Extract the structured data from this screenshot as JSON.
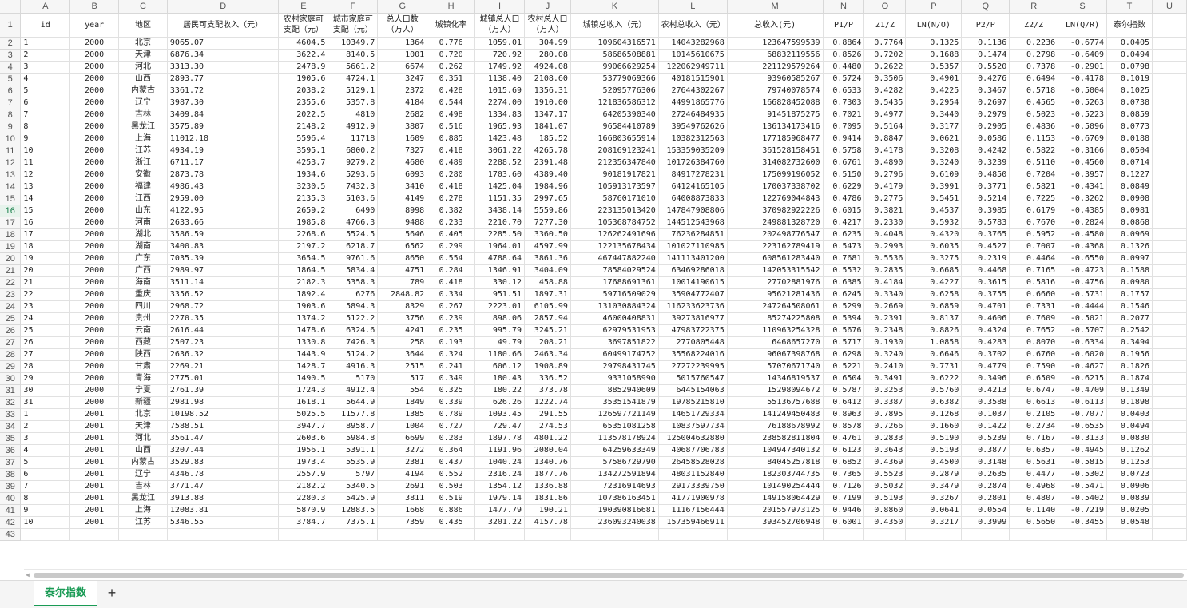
{
  "columns": [
    "A",
    "B",
    "C",
    "D",
    "E",
    "F",
    "G",
    "H",
    "I",
    "J",
    "K",
    "L",
    "M",
    "N",
    "O",
    "P",
    "Q",
    "R",
    "S",
    "T",
    "U"
  ],
  "headers": [
    "id",
    "year",
    "地区",
    "居民可支配收入（元）",
    "农村家庭可支配（元）",
    "城市家庭可支配（元）",
    "总人口数（万人）",
    "城镇化率",
    "城镇总人口（万人）",
    "农村总人口（万人）",
    "城镇总收入（元）",
    "农村总收入（元）",
    "总收入(元)",
    "P1/P",
    "Z1/Z",
    "LN(N/O)",
    "P2/P",
    "Z2/Z",
    "LN(Q/R)",
    "泰尔指数",
    ""
  ],
  "rows": [
    [
      "1",
      "2000",
      "北京",
      "9065.07",
      "4604.5",
      "10349.7",
      "1364",
      "0.776",
      "1059.01",
      "304.99",
      "109604316571",
      "14043282968",
      "123647599539",
      "0.8864",
      "0.7764",
      "0.1325",
      "0.1136",
      "0.2236",
      "-0.6774",
      "0.0405"
    ],
    [
      "2",
      "2000",
      "天津",
      "6876.34",
      "3622.4",
      "8140.5",
      "1001",
      "0.720",
      "720.92",
      "280.08",
      "58686508881",
      "10145610675",
      "68832119556",
      "0.8526",
      "0.7202",
      "0.1688",
      "0.1474",
      "0.2798",
      "-0.6409",
      "0.0494"
    ],
    [
      "3",
      "2000",
      "河北",
      "3313.30",
      "2478.9",
      "5661.2",
      "6674",
      "0.262",
      "1749.92",
      "4924.08",
      "99066629254",
      "122062949711",
      "221129579264",
      "0.4480",
      "0.2622",
      "0.5357",
      "0.5520",
      "0.7378",
      "-0.2901",
      "0.0798"
    ],
    [
      "4",
      "2000",
      "山西",
      "2893.77",
      "1905.6",
      "4724.1",
      "3247",
      "0.351",
      "1138.40",
      "2108.60",
      "53779069366",
      "40181515901",
      "93960585267",
      "0.5724",
      "0.3506",
      "0.4901",
      "0.4276",
      "0.6494",
      "-0.4178",
      "0.1019"
    ],
    [
      "5",
      "2000",
      "内蒙古",
      "3361.72",
      "2038.2",
      "5129.1",
      "2372",
      "0.428",
      "1015.69",
      "1356.31",
      "52095776306",
      "27644302267",
      "79740078574",
      "0.6533",
      "0.4282",
      "0.4225",
      "0.3467",
      "0.5718",
      "-0.5004",
      "0.1025"
    ],
    [
      "6",
      "2000",
      "辽宁",
      "3987.30",
      "2355.6",
      "5357.8",
      "4184",
      "0.544",
      "2274.00",
      "1910.00",
      "121836586312",
      "44991865776",
      "166828452088",
      "0.7303",
      "0.5435",
      "0.2954",
      "0.2697",
      "0.4565",
      "-0.5263",
      "0.0738"
    ],
    [
      "7",
      "2000",
      "吉林",
      "3409.84",
      "2022.5",
      "4810",
      "2682",
      "0.498",
      "1334.83",
      "1347.17",
      "64205390340",
      "27246484935",
      "91451875275",
      "0.7021",
      "0.4977",
      "0.3440",
      "0.2979",
      "0.5023",
      "-0.5223",
      "0.0859"
    ],
    [
      "8",
      "2000",
      "黑龙江",
      "3575.89",
      "2148.2",
      "4912.9",
      "3807",
      "0.516",
      "1965.93",
      "1841.07",
      "96584410789",
      "39549762626",
      "136134173416",
      "0.7095",
      "0.5164",
      "0.3177",
      "0.2905",
      "0.4836",
      "-0.5096",
      "0.0773"
    ],
    [
      "9",
      "2000",
      "上海",
      "11012.18",
      "5596.4",
      "11718",
      "1609",
      "0.885",
      "1423.48",
      "185.52",
      "166803655914",
      "10382312563",
      "177185968477",
      "0.9414",
      "0.8847",
      "0.0621",
      "0.0586",
      "0.1153",
      "-0.6769",
      "0.0188"
    ],
    [
      "10",
      "2000",
      "江苏",
      "4934.19",
      "3595.1",
      "6800.2",
      "7327",
      "0.418",
      "3061.22",
      "4265.78",
      "208169123241",
      "153359035209",
      "361528158451",
      "0.5758",
      "0.4178",
      "0.3208",
      "0.4242",
      "0.5822",
      "-0.3166",
      "0.0504"
    ],
    [
      "11",
      "2000",
      "浙江",
      "6711.17",
      "4253.7",
      "9279.2",
      "4680",
      "0.489",
      "2288.52",
      "2391.48",
      "212356347840",
      "101726384760",
      "314082732600",
      "0.6761",
      "0.4890",
      "0.3240",
      "0.3239",
      "0.5110",
      "-0.4560",
      "0.0714"
    ],
    [
      "12",
      "2000",
      "安徽",
      "2873.78",
      "1934.6",
      "5293.6",
      "6093",
      "0.280",
      "1703.60",
      "4389.40",
      "90181917821",
      "84917278231",
      "175099196052",
      "0.5150",
      "0.2796",
      "0.6109",
      "0.4850",
      "0.7204",
      "-0.3957",
      "0.1227"
    ],
    [
      "13",
      "2000",
      "福建",
      "4986.43",
      "3230.5",
      "7432.3",
      "3410",
      "0.418",
      "1425.04",
      "1984.96",
      "105913173597",
      "64124165105",
      "170037338702",
      "0.6229",
      "0.4179",
      "0.3991",
      "0.3771",
      "0.5821",
      "-0.4341",
      "0.0849"
    ],
    [
      "14",
      "2000",
      "江西",
      "2959.00",
      "2135.3",
      "5103.6",
      "4149",
      "0.278",
      "1151.35",
      "2997.65",
      "58760171010",
      "64008873833",
      "122769044843",
      "0.4786",
      "0.2775",
      "0.5451",
      "0.5214",
      "0.7225",
      "-0.3262",
      "0.0908"
    ],
    [
      "15",
      "2000",
      "山东",
      "4122.95",
      "2659.2",
      "6490",
      "8998",
      "0.382",
      "3438.14",
      "5559.86",
      "223135013420",
      "147847908806",
      "370982922226",
      "0.6015",
      "0.3821",
      "0.4537",
      "0.3985",
      "0.6179",
      "-0.4385",
      "0.0981"
    ],
    [
      "16",
      "2000",
      "河南",
      "2633.66",
      "1985.8",
      "4766.3",
      "9488",
      "0.233",
      "2210.70",
      "7277.30",
      "105368784752",
      "144512543968",
      "249881328720",
      "0.4217",
      "0.2330",
      "0.5932",
      "0.5783",
      "0.7670",
      "-0.2824",
      "0.0868"
    ],
    [
      "17",
      "2000",
      "湖北",
      "3586.59",
      "2268.6",
      "5524.5",
      "5646",
      "0.405",
      "2285.50",
      "3360.50",
      "126262491696",
      "76236284851",
      "202498776547",
      "0.6235",
      "0.4048",
      "0.4320",
      "0.3765",
      "0.5952",
      "-0.4580",
      "0.0969"
    ],
    [
      "18",
      "2000",
      "湖南",
      "3400.83",
      "2197.2",
      "6218.7",
      "6562",
      "0.299",
      "1964.01",
      "4597.99",
      "122135678434",
      "101027110985",
      "223162789419",
      "0.5473",
      "0.2993",
      "0.6035",
      "0.4527",
      "0.7007",
      "-0.4368",
      "0.1326"
    ],
    [
      "19",
      "2000",
      "广东",
      "7035.39",
      "3654.5",
      "9761.6",
      "8650",
      "0.554",
      "4788.64",
      "3861.36",
      "467447882240",
      "141113401200",
      "608561283440",
      "0.7681",
      "0.5536",
      "0.3275",
      "0.2319",
      "0.4464",
      "-0.6550",
      "0.0997"
    ],
    [
      "20",
      "2000",
      "广西",
      "2989.97",
      "1864.5",
      "5834.4",
      "4751",
      "0.284",
      "1346.91",
      "3404.09",
      "78584029524",
      "63469286018",
      "142053315542",
      "0.5532",
      "0.2835",
      "0.6685",
      "0.4468",
      "0.7165",
      "-0.4723",
      "0.1588"
    ],
    [
      "21",
      "2000",
      "海南",
      "3511.14",
      "2182.3",
      "5358.3",
      "789",
      "0.418",
      "330.12",
      "458.88",
      "17688691361",
      "10014190615",
      "27702881976",
      "0.6385",
      "0.4184",
      "0.4227",
      "0.3615",
      "0.5816",
      "-0.4756",
      "0.0980"
    ],
    [
      "22",
      "2000",
      "重庆",
      "3356.52",
      "1892.4",
      "6276",
      "2848.82",
      "0.334",
      "951.51",
      "1897.31",
      "59716509029",
      "35904772407",
      "95621281436",
      "0.6245",
      "0.3340",
      "0.6258",
      "0.3755",
      "0.6660",
      "-0.5731",
      "0.1757"
    ],
    [
      "23",
      "2000",
      "四川",
      "2968.72",
      "1903.6",
      "5894.3",
      "8329",
      "0.267",
      "2223.01",
      "6105.99",
      "131030884324",
      "116233623736",
      "247264508061",
      "0.5299",
      "0.2669",
      "0.6859",
      "0.4701",
      "0.7331",
      "-0.4444",
      "0.1546"
    ],
    [
      "24",
      "2000",
      "贵州",
      "2270.35",
      "1374.2",
      "5122.2",
      "3756",
      "0.239",
      "898.06",
      "2857.94",
      "46000408831",
      "39273816977",
      "85274225808",
      "0.5394",
      "0.2391",
      "0.8137",
      "0.4606",
      "0.7609",
      "-0.5021",
      "0.2077"
    ],
    [
      "25",
      "2000",
      "云南",
      "2616.44",
      "1478.6",
      "6324.6",
      "4241",
      "0.235",
      "995.79",
      "3245.21",
      "62979531953",
      "47983722375",
      "110963254328",
      "0.5676",
      "0.2348",
      "0.8826",
      "0.4324",
      "0.7652",
      "-0.5707",
      "0.2542"
    ],
    [
      "26",
      "2000",
      "西藏",
      "2507.23",
      "1330.8",
      "7426.3",
      "258",
      "0.193",
      "49.79",
      "208.21",
      "3697851822",
      "2770805448",
      "6468657270",
      "0.5717",
      "0.1930",
      "1.0858",
      "0.4283",
      "0.8070",
      "-0.6334",
      "0.3494"
    ],
    [
      "27",
      "2000",
      "陕西",
      "2636.32",
      "1443.9",
      "5124.2",
      "3644",
      "0.324",
      "1180.66",
      "2463.34",
      "60499174752",
      "35568224016",
      "96067398768",
      "0.6298",
      "0.3240",
      "0.6646",
      "0.3702",
      "0.6760",
      "-0.6020",
      "0.1956"
    ],
    [
      "28",
      "2000",
      "甘肃",
      "2269.21",
      "1428.7",
      "4916.3",
      "2515",
      "0.241",
      "606.12",
      "1908.89",
      "29798431745",
      "27272239995",
      "57070671740",
      "0.5221",
      "0.2410",
      "0.7731",
      "0.4779",
      "0.7590",
      "-0.4627",
      "0.1826"
    ],
    [
      "29",
      "2000",
      "青海",
      "2775.01",
      "1490.5",
      "5170",
      "517",
      "0.349",
      "180.43",
      "336.52",
      "9331058990",
      "5015760547",
      "14346819537",
      "0.6504",
      "0.3491",
      "0.6222",
      "0.3496",
      "0.6509",
      "-0.6215",
      "0.1874"
    ],
    [
      "30",
      "2000",
      "宁夏",
      "2761.39",
      "1724.3",
      "4912.4",
      "554",
      "0.325",
      "180.22",
      "373.78",
      "8852940609",
      "6445154063",
      "15298094672",
      "0.5787",
      "0.3253",
      "0.5760",
      "0.4213",
      "0.6747",
      "-0.4709",
      "0.1349"
    ],
    [
      "31",
      "2000",
      "新疆",
      "2981.98",
      "1618.1",
      "5644.9",
      "1849",
      "0.339",
      "626.26",
      "1222.74",
      "35351541879",
      "19785215810",
      "55136757688",
      "0.6412",
      "0.3387",
      "0.6382",
      "0.3588",
      "0.6613",
      "-0.6113",
      "0.1898"
    ],
    [
      "1",
      "2001",
      "北京",
      "10198.52",
      "5025.5",
      "11577.8",
      "1385",
      "0.789",
      "1093.45",
      "291.55",
      "126597721149",
      "14651729334",
      "141249450483",
      "0.8963",
      "0.7895",
      "0.1268",
      "0.1037",
      "0.2105",
      "-0.7077",
      "0.0403"
    ],
    [
      "2",
      "2001",
      "天津",
      "7588.51",
      "3947.7",
      "8958.7",
      "1004",
      "0.727",
      "729.47",
      "274.53",
      "65351081258",
      "10837597734",
      "76188678992",
      "0.8578",
      "0.7266",
      "0.1660",
      "0.1422",
      "0.2734",
      "-0.6535",
      "0.0494"
    ],
    [
      "3",
      "2001",
      "河北",
      "3561.47",
      "2603.6",
      "5984.8",
      "6699",
      "0.283",
      "1897.78",
      "4801.22",
      "113578178924",
      "125004632880",
      "238582811804",
      "0.4761",
      "0.2833",
      "0.5190",
      "0.5239",
      "0.7167",
      "-0.3133",
      "0.0830"
    ],
    [
      "4",
      "2001",
      "山西",
      "3207.44",
      "1956.1",
      "5391.1",
      "3272",
      "0.364",
      "1191.96",
      "2080.04",
      "64259633349",
      "40687706783",
      "104947340132",
      "0.6123",
      "0.3643",
      "0.5193",
      "0.3877",
      "0.6357",
      "-0.4945",
      "0.1262"
    ],
    [
      "5",
      "2001",
      "内蒙古",
      "3529.83",
      "1973.4",
      "5535.9",
      "2381",
      "0.437",
      "1040.24",
      "1340.76",
      "57586729790",
      "26458528028",
      "84045257818",
      "0.6852",
      "0.4369",
      "0.4500",
      "0.3148",
      "0.5631",
      "-0.5815",
      "0.1253"
    ],
    [
      "6",
      "2001",
      "辽宁",
      "4346.78",
      "2557.9",
      "5797",
      "4194",
      "0.552",
      "2316.24",
      "1877.76",
      "134272591894",
      "48031152840",
      "182303744735",
      "0.7365",
      "0.5523",
      "0.2879",
      "0.2635",
      "0.4477",
      "-0.5302",
      "0.0723"
    ],
    [
      "7",
      "2001",
      "吉林",
      "3771.47",
      "2182.2",
      "5340.5",
      "2691",
      "0.503",
      "1354.12",
      "1336.88",
      "72316914693",
      "29173339750",
      "101490254444",
      "0.7126",
      "0.5032",
      "0.3479",
      "0.2874",
      "0.4968",
      "-0.5471",
      "0.0906"
    ],
    [
      "8",
      "2001",
      "黑龙江",
      "3913.88",
      "2280.3",
      "5425.9",
      "3811",
      "0.519",
      "1979.14",
      "1831.86",
      "107386163451",
      "41771900978",
      "149158064429",
      "0.7199",
      "0.5193",
      "0.3267",
      "0.2801",
      "0.4807",
      "-0.5402",
      "0.0839"
    ],
    [
      "9",
      "2001",
      "上海",
      "12083.81",
      "5870.9",
      "12883.5",
      "1668",
      "0.886",
      "1477.79",
      "190.21",
      "190390816681",
      "11167156444",
      "201557973125",
      "0.9446",
      "0.8860",
      "0.0641",
      "0.0554",
      "0.1140",
      "-0.7219",
      "0.0205"
    ],
    [
      "10",
      "2001",
      "江苏",
      "5346.55",
      "3784.7",
      "7375.1",
      "7359",
      "0.435",
      "3201.22",
      "4157.78",
      "236093240038",
      "157359466911",
      "393452706948",
      "0.6001",
      "0.4350",
      "0.3217",
      "0.3999",
      "0.5650",
      "-0.3455",
      "0.0548"
    ]
  ],
  "partial_row_number": "43",
  "sheet_tab": "泰尔指数",
  "add_sheet_icon": "plus-icon"
}
